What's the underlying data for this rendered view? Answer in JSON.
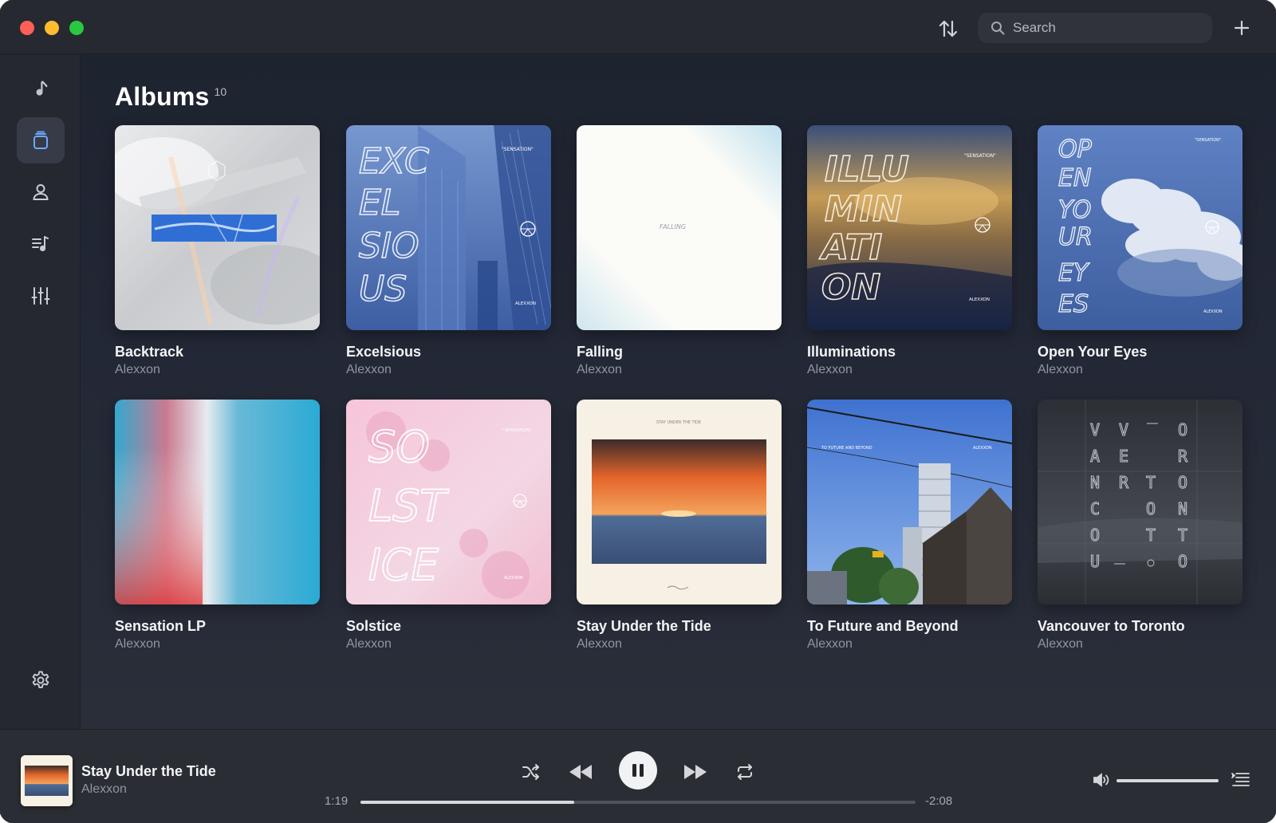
{
  "window": {
    "traffic_lights": [
      "close",
      "minimize",
      "zoom"
    ]
  },
  "toolbar": {
    "sort_icon": "sort-arrows-icon",
    "search": {
      "placeholder": "Search",
      "value": ""
    },
    "add_icon": "plus-icon"
  },
  "sidebar": {
    "items": [
      {
        "name": "songs",
        "icon": "music-note-icon",
        "active": false
      },
      {
        "name": "albums",
        "icon": "albums-stack-icon",
        "active": true
      },
      {
        "name": "artists",
        "icon": "person-icon",
        "active": false
      },
      {
        "name": "playlists",
        "icon": "playlist-icon",
        "active": false
      },
      {
        "name": "equalizer",
        "icon": "sliders-icon",
        "active": false
      }
    ],
    "settings_icon": "gear-icon"
  },
  "main": {
    "title": "Albums",
    "count": "10",
    "albums": [
      {
        "title": "Backtrack",
        "artist": "Alexxon"
      },
      {
        "title": "Excelsious",
        "artist": "Alexxon",
        "cover_text": [
          "EXC",
          "EL",
          "SIO",
          "US"
        ],
        "label": "\"SENSATION\"",
        "imprint": "ALEXXON"
      },
      {
        "title": "Falling",
        "artist": "Alexxon",
        "cover_text": [
          "FALLING"
        ]
      },
      {
        "title": "Illuminations",
        "artist": "Alexxon",
        "cover_text": [
          "ILLU",
          "MIN",
          "ATI",
          "ON"
        ],
        "label": "\"SENSATION\"",
        "imprint": "ALEXXON"
      },
      {
        "title": "Open Your Eyes",
        "artist": "Alexxon",
        "cover_text": [
          "OP",
          "EN",
          "YO",
          "UR",
          "EY",
          "ES"
        ],
        "label": "\"SENSATION\"",
        "imprint": "ALEXXON"
      },
      {
        "title": "Sensation LP",
        "artist": "Alexxon"
      },
      {
        "title": "Solstice",
        "artist": "Alexxon",
        "cover_text": [
          "SO",
          "LST",
          "ICE"
        ],
        "label": "\"SENSATION\"",
        "imprint": "ALEXXON"
      },
      {
        "title": "Stay Under the Tide",
        "artist": "Alexxon",
        "cover_text": [
          "STAY UNDER THE TIDE"
        ]
      },
      {
        "title": "To Future and Beyond",
        "artist": "Alexxon",
        "cover_text": [
          "TO FUTURE AND BEYOND"
        ],
        "imprint": "ALEXXON"
      },
      {
        "title": "Vancouver to Toronto",
        "artist": "Alexxon",
        "cover_text": [
          "VANCOUVER",
          "TORONTO"
        ]
      }
    ]
  },
  "player": {
    "title": "Stay Under the Tide",
    "artist": "Alexxon",
    "elapsed": "1:19",
    "remaining": "-2:08",
    "progress": 0.385,
    "volume": 1.0,
    "state": "playing",
    "controls": [
      "shuffle-icon",
      "rewind-icon",
      "pause-icon",
      "fast-forward-icon",
      "repeat-icon",
      "volume-icon",
      "queue-list-icon"
    ]
  },
  "colors": {
    "accent": "#6aa8ff",
    "background": "#22252d",
    "sidebar": "#25282f"
  }
}
